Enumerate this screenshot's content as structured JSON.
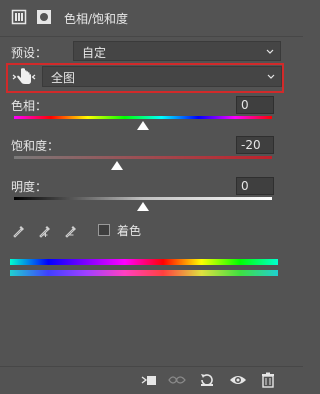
{
  "header": {
    "title": "色相/饱和度",
    "icons": [
      "adjustment-layer-icon",
      "layer-mask-icon"
    ]
  },
  "preset": {
    "label": "预设：",
    "value": "自定"
  },
  "range": {
    "value": "全图",
    "icon": "hand-target-icon"
  },
  "hue": {
    "label": "色相：",
    "value": "0",
    "level_fraction": 0.5
  },
  "saturation": {
    "label": "饱和度：",
    "value": "-20",
    "level_fraction": 0.4
  },
  "lightness": {
    "label": "明度：",
    "value": "0",
    "level_fraction": 0.5
  },
  "tools": {
    "icons": [
      "eyedropper-icon",
      "eyedropper-plus-icon",
      "eyedropper-minus-icon"
    ],
    "colorize_label": "着色",
    "colorize_checked": false
  },
  "footer": {
    "icons": [
      "clip-to-layer-icon",
      "view-previous-state-icon",
      "reset-icon",
      "visibility-eye-icon",
      "delete-trash-icon"
    ]
  },
  "colors": {
    "panel_bg": "#535353",
    "highlight": "#d22a2a"
  }
}
